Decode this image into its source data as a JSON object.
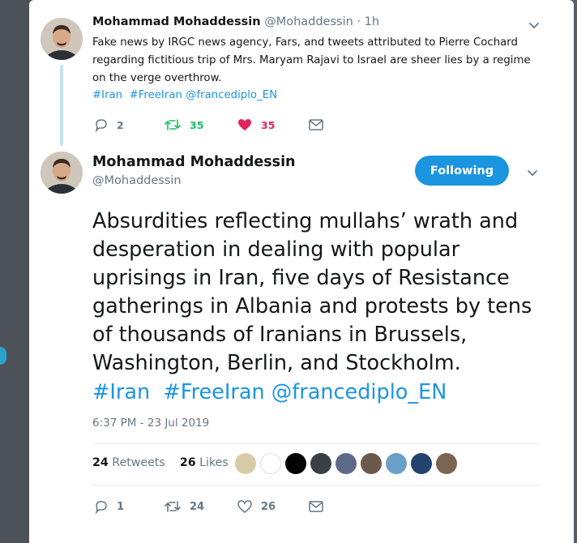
{
  "tweet1": {
    "name": "Mohammad Mohaddessin",
    "handle": "@Mohaddessin",
    "time": "· 1h",
    "text": "Fake news by IRGC news agency, Fars, and tweets attributed to Pierre Cochard regarding fictitious trip of Mrs. Maryam Rajavi to Israel are sheer lies by a regime on the verge overthrow.",
    "hashtag1": "#Iran",
    "hashtag2": "#FreeIran",
    "mention": "@francediplo_EN",
    "replies": "2",
    "retweets": "35",
    "likes": "35",
    "colors": {
      "retweet": "#17bf63",
      "like": "#e0245e"
    }
  },
  "tweet2": {
    "name": "Mohammad Mohaddessin",
    "handle": "@Mohaddessin",
    "follow_label": "Following",
    "text": "Absurdities reflecting mullahs’ wrath and desperation in dealing with popular uprisings in Iran, five days of  Resistance gatherings in Albania and protests by tens of thousands of Iranians in Brussels, Washington, Berlin, and Stockholm.",
    "hashtag1": "#Iran",
    "hashtag2": "#FreeIran",
    "mention": "@francediplo_EN",
    "timestamp": "6:37 PM - 23 Jul 2019",
    "retweet_count": "24",
    "retweet_label": "Retweets",
    "like_count": "26",
    "like_label": "Likes",
    "replies": "1",
    "retweets": "24",
    "likes": "26"
  },
  "icons": [
    "reply-icon",
    "retweet-icon",
    "heart-icon",
    "envelope-icon",
    "chevron-down-icon"
  ],
  "accent": "#1b95e0"
}
